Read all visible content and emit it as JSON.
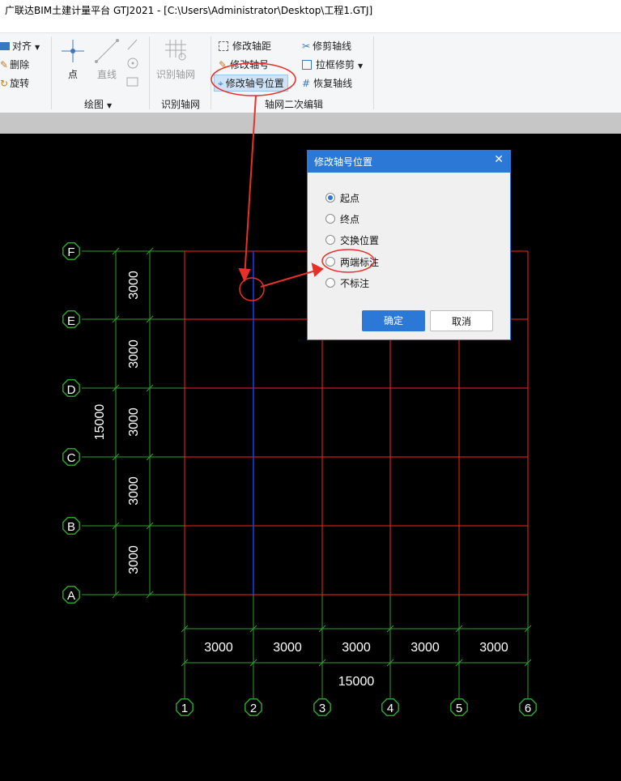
{
  "window": {
    "title": "广联达BIM土建计量平台 GTJ2021 - [C:\\Users\\Administrator\\Desktop\\工程1.GTJ]"
  },
  "ribbon": {
    "edit": {
      "align": "对齐",
      "delete": "删除",
      "rotate": "旋转"
    },
    "draw": {
      "point": "点",
      "line": "直线",
      "group": "绘图"
    },
    "identify": {
      "identify_grid": "识别轴网",
      "group": "识别轴网"
    },
    "grid_edit": {
      "modify_spacing": "修改轴距",
      "modify_number": "修改轴号",
      "modify_number_position": "修改轴号位置",
      "trim_grid": "修剪轴线",
      "box_trim": "拉框修剪",
      "restore_grid": "恢复轴线",
      "group": "轴网二次编辑"
    }
  },
  "drawing": {
    "row_labels": [
      "F",
      "E",
      "D",
      "C",
      "B",
      "A"
    ],
    "row_spacings": [
      "3000",
      "3000",
      "3000",
      "3000",
      "3000"
    ],
    "row_total": "15000",
    "column_labels": [
      "1",
      "2",
      "3",
      "4",
      "5",
      "6"
    ],
    "column_spacings": [
      "3000",
      "3000",
      "3000",
      "3000",
      "3000"
    ],
    "column_total": "15000",
    "colors": {
      "grid": "#ff2222",
      "dimension": "#2e9e2e",
      "selected_axis": "#1a3cff",
      "annotation": "#e8302a"
    }
  },
  "dialog": {
    "title": "修改轴号位置",
    "options": [
      {
        "label": "起点",
        "selected": true
      },
      {
        "label": "终点",
        "selected": false
      },
      {
        "label": "交换位置",
        "selected": false
      },
      {
        "label": "两端标注",
        "selected": false
      },
      {
        "label": "不标注",
        "selected": false
      }
    ],
    "ok": "确定",
    "cancel": "取消"
  }
}
